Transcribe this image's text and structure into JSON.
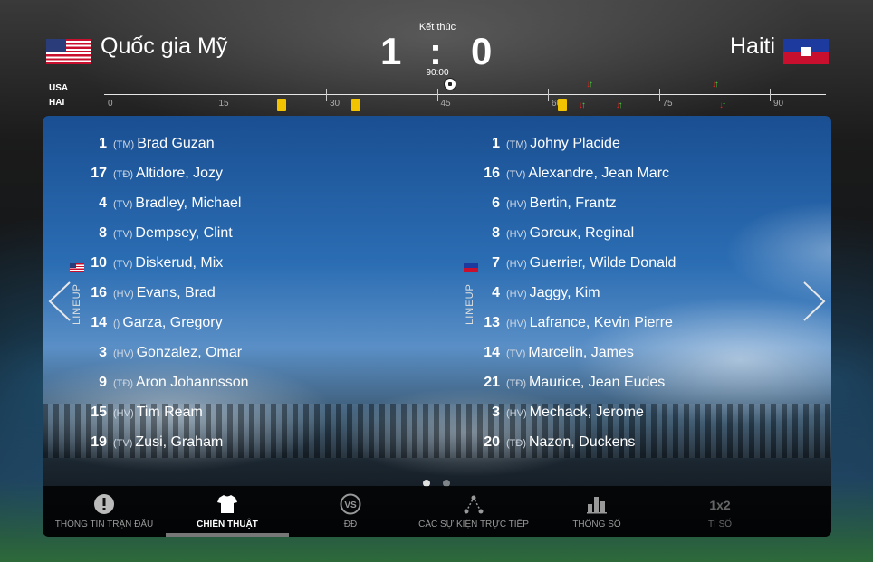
{
  "header": {
    "status": "Kết thúc",
    "time": "90:00",
    "home": {
      "name": "Quốc gia Mỹ",
      "code": "USA",
      "score": "1"
    },
    "away": {
      "name": "Haiti",
      "code": "HAI",
      "score": "0"
    },
    "separator": ":"
  },
  "timeline": {
    "labels": [
      "0",
      "15",
      "30",
      "45",
      "60",
      "75",
      "90"
    ],
    "events": [
      {
        "team": "HAI",
        "type": "yellow-card",
        "minute": 24
      },
      {
        "team": "HAI",
        "type": "yellow-card",
        "minute": 34
      },
      {
        "team": "HAI",
        "type": "yellow-card",
        "minute": 62
      },
      {
        "team": "USA",
        "type": "goal",
        "minute": 46
      },
      {
        "team": "USA",
        "type": "substitution",
        "minute": 66
      },
      {
        "team": "USA",
        "type": "substitution",
        "minute": 83
      },
      {
        "team": "HAI",
        "type": "substitution",
        "minute": 65
      },
      {
        "team": "HAI",
        "type": "substitution",
        "minute": 70
      },
      {
        "team": "HAI",
        "type": "substitution",
        "minute": 84
      }
    ]
  },
  "lineup_label": "LINEUP",
  "home_players": [
    {
      "num": "1",
      "pos": "(TM)",
      "name": "Brad Guzan"
    },
    {
      "num": "17",
      "pos": "(TĐ)",
      "name": "Altidore, Jozy"
    },
    {
      "num": "4",
      "pos": "(TV)",
      "name": "Bradley, Michael"
    },
    {
      "num": "8",
      "pos": "(TV)",
      "name": "Dempsey, Clint"
    },
    {
      "num": "10",
      "pos": "(TV)",
      "name": "Diskerud, Mix",
      "captain": true
    },
    {
      "num": "16",
      "pos": "(HV)",
      "name": "Evans, Brad"
    },
    {
      "num": "14",
      "pos": "()",
      "name": "Garza, Gregory"
    },
    {
      "num": "3",
      "pos": "(HV)",
      "name": "Gonzalez, Omar"
    },
    {
      "num": "9",
      "pos": "(TĐ)",
      "name": "Aron Johannsson"
    },
    {
      "num": "15",
      "pos": "(HV)",
      "name": "Tim Ream"
    },
    {
      "num": "19",
      "pos": "(TV)",
      "name": "Zusi, Graham"
    }
  ],
  "away_players": [
    {
      "num": "1",
      "pos": "(TM)",
      "name": "Johny Placide"
    },
    {
      "num": "16",
      "pos": "(TV)",
      "name": "Alexandre, Jean Marc"
    },
    {
      "num": "6",
      "pos": "(HV)",
      "name": "Bertin, Frantz"
    },
    {
      "num": "8",
      "pos": "(HV)",
      "name": "Goreux, Reginal"
    },
    {
      "num": "7",
      "pos": "(HV)",
      "name": "Guerrier, Wilde Donald",
      "captain": true
    },
    {
      "num": "4",
      "pos": "(HV)",
      "name": "Jaggy, Kim"
    },
    {
      "num": "13",
      "pos": "(HV)",
      "name": "Lafrance, Kevin Pierre"
    },
    {
      "num": "14",
      "pos": "(TV)",
      "name": "Marcelin, James"
    },
    {
      "num": "21",
      "pos": "(TĐ)",
      "name": "Maurice, Jean Eudes"
    },
    {
      "num": "3",
      "pos": "(HV)",
      "name": "Mechack, Jerome"
    },
    {
      "num": "20",
      "pos": "(TĐ)",
      "name": "Nazon, Duckens"
    }
  ],
  "pagination": {
    "pages": 2,
    "current": 1
  },
  "tabs": [
    {
      "label": "THÔNG TIN TRẬN ĐẤU",
      "icon": "alert-icon",
      "state": "normal"
    },
    {
      "label": "CHIẾN THUẬT",
      "icon": "shirt-icon",
      "state": "active"
    },
    {
      "label": "ĐĐ",
      "icon": "vs-icon",
      "state": "normal",
      "icon_text": "VS"
    },
    {
      "label": "CÁC SỰ KIỆN TRỰC TIẾP",
      "icon": "timeline-nodes-icon",
      "state": "normal"
    },
    {
      "label": "THỐNG SỐ",
      "icon": "bar-chart-icon",
      "state": "normal"
    },
    {
      "label": "TỈ SỐ",
      "icon": "odds-icon",
      "state": "disabled",
      "icon_text": "1x2"
    }
  ],
  "colors": {
    "yellow_card": "#f2c300",
    "sub_in": "#3ed43e",
    "sub_out": "#e52222",
    "tab_active_bar": "#777777"
  }
}
